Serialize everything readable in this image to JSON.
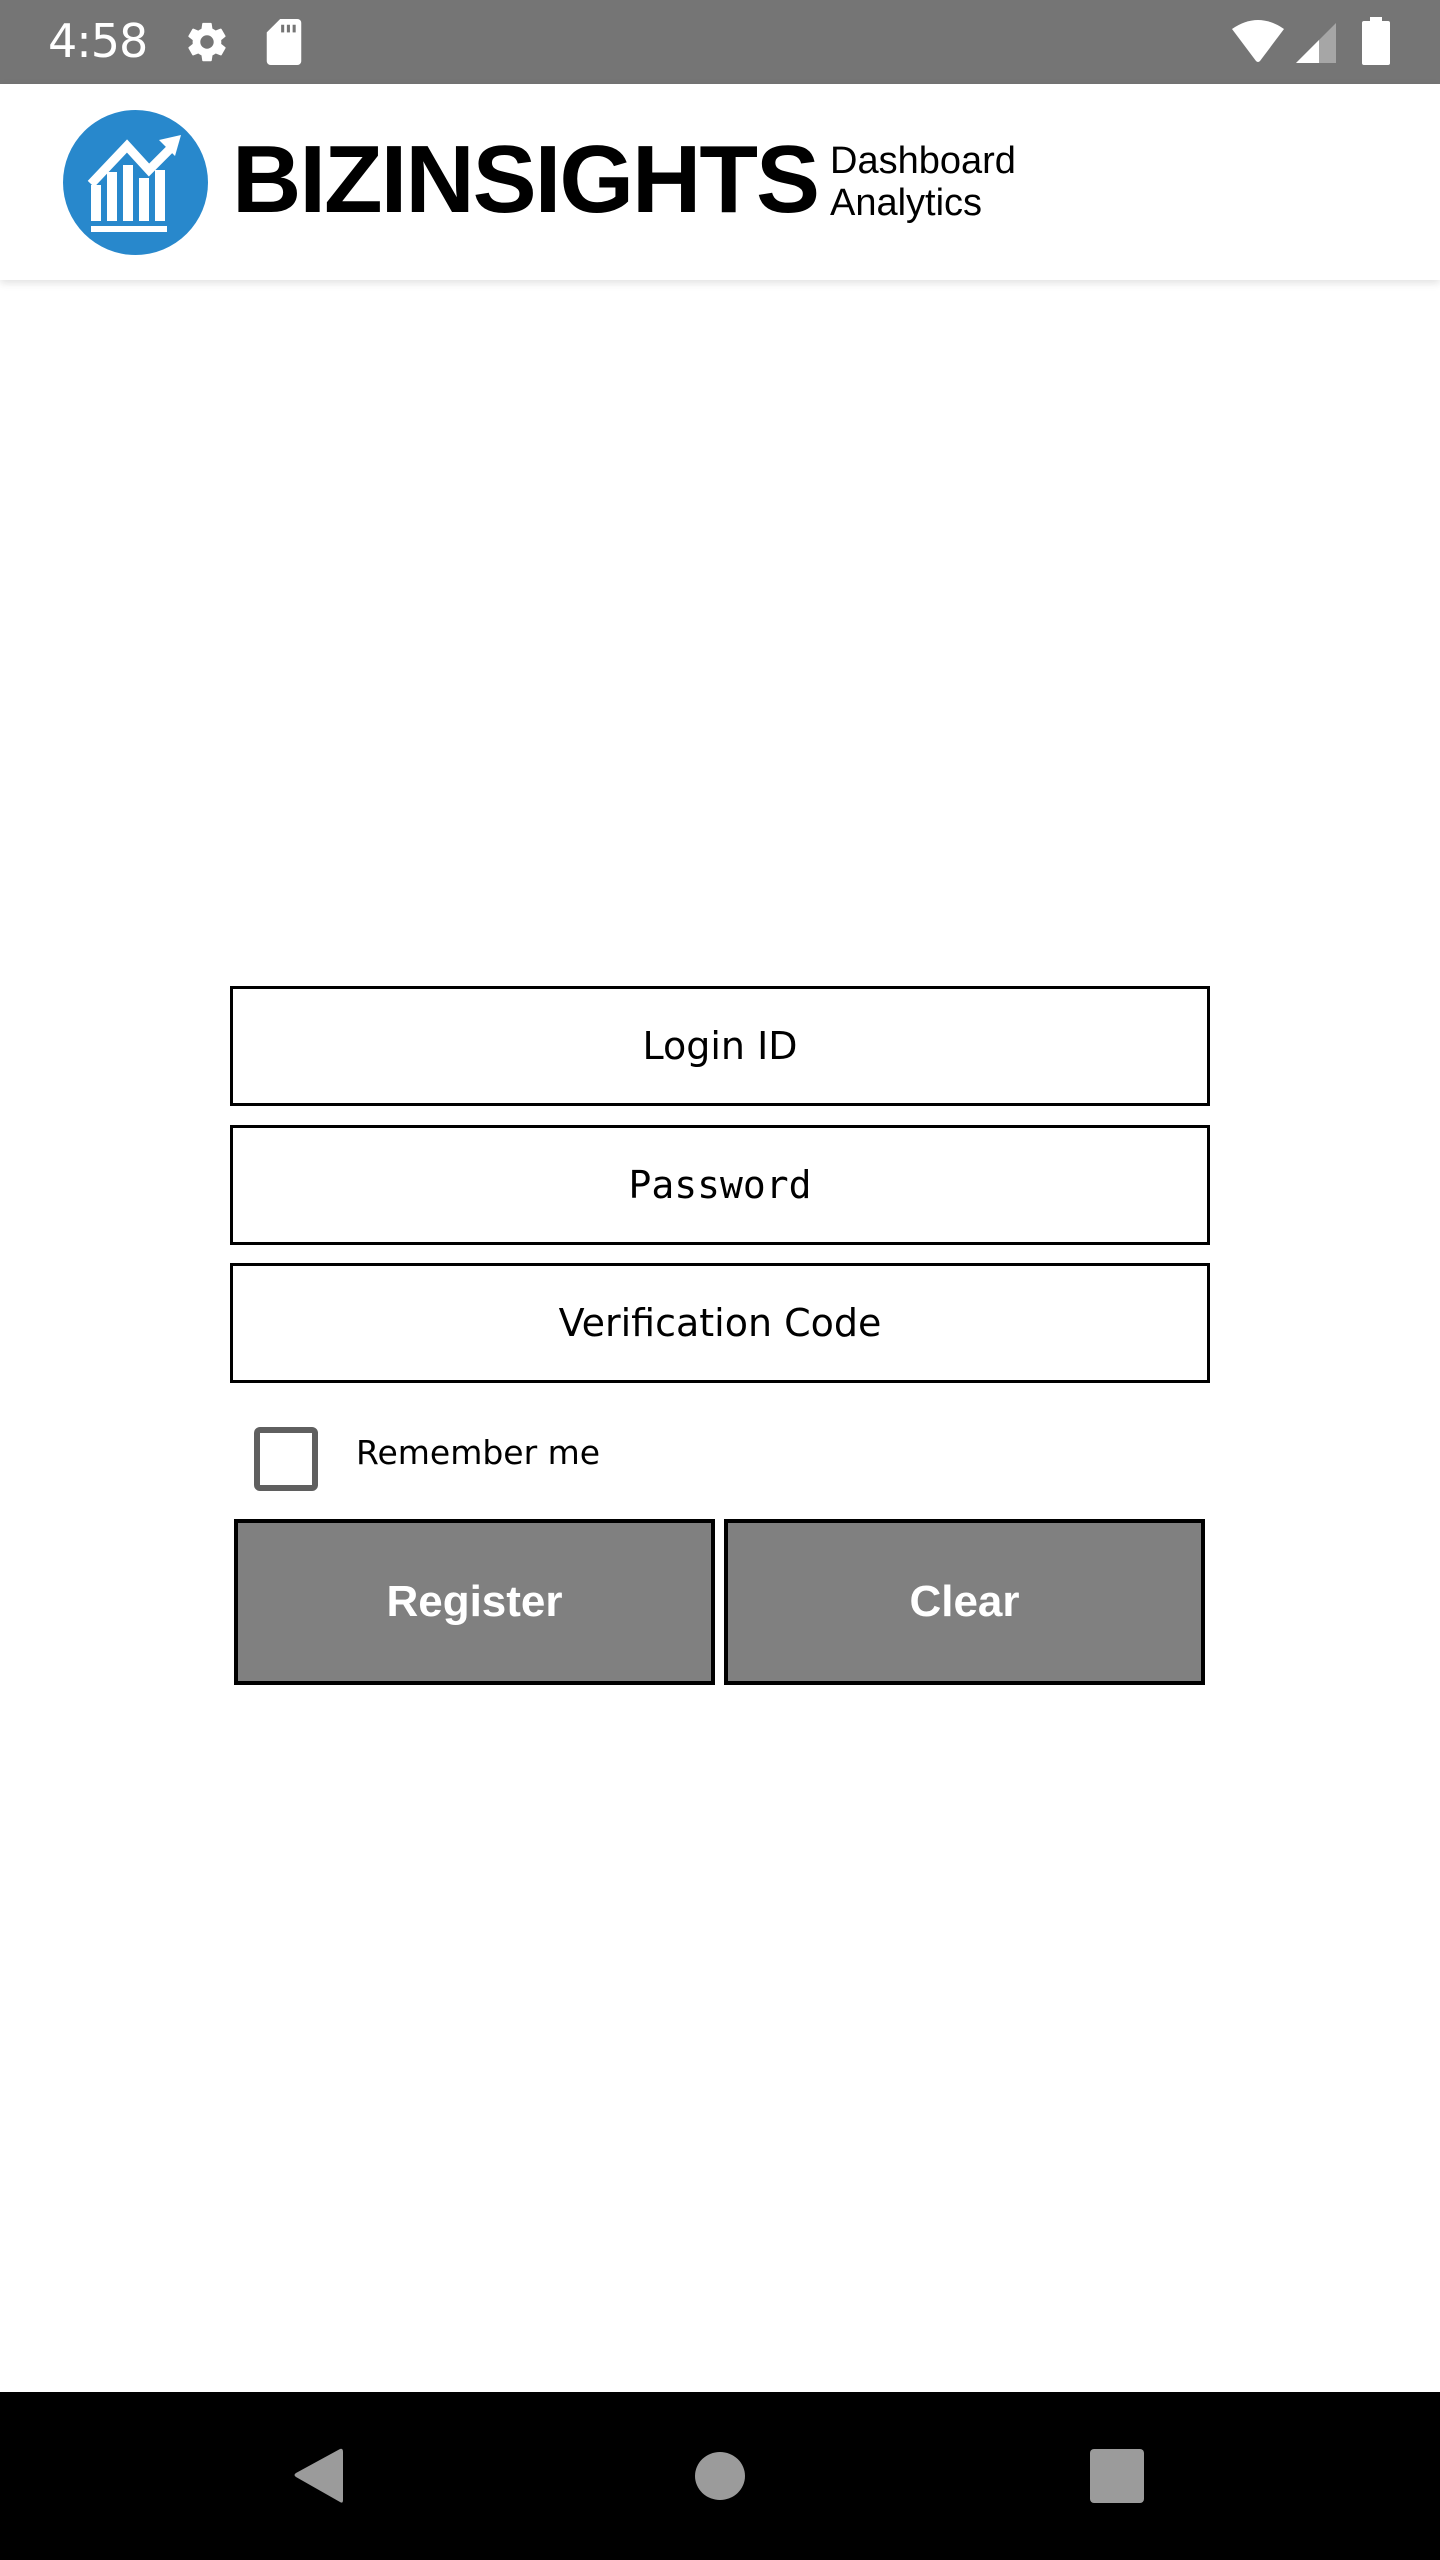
{
  "status_bar": {
    "time": "4:58",
    "left_icons": [
      "gear-icon",
      "sd-card-icon"
    ],
    "right_icons": [
      "wifi-icon",
      "cell-signal-icon",
      "battery-icon"
    ],
    "background_color": "#757575"
  },
  "header": {
    "logo_icon": "bar-chart-trend-up-icon",
    "logo_color": "#2888cc",
    "brand_name": "BIZINSIGHTS",
    "subtitle_line1": "Dashboard",
    "subtitle_line2": "Analytics"
  },
  "form": {
    "login_id": {
      "value": "",
      "placeholder": "Login ID"
    },
    "password": {
      "value": "",
      "placeholder": "Password"
    },
    "verification_code": {
      "value": "",
      "placeholder": "Verification Code"
    },
    "remember_me": {
      "label": "Remember me",
      "checked": false
    },
    "register_button": "Register",
    "clear_button": "Clear",
    "button_color": "#808080"
  },
  "nav_bar": {
    "buttons": [
      "back",
      "home",
      "recents"
    ]
  }
}
